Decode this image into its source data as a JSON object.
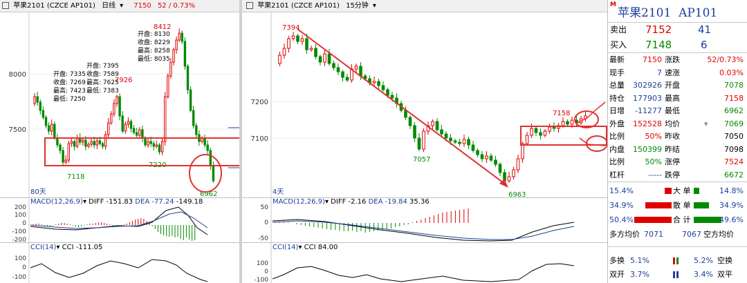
{
  "colors": {
    "up": "#e00000",
    "down": "#008a00",
    "bg": "#ffffff",
    "grid": "#d8d8d8",
    "annot": "#e03030",
    "blue": "#1d3f9c"
  },
  "left_panel": {
    "header": {
      "name": "苹果2101 (CZCE AP101)",
      "period": "日线",
      "dropdown": "▾",
      "price": "7150",
      "change": "52 / 0.73%"
    },
    "price_axis": [
      "8000",
      "7500"
    ],
    "peak_label": "8412",
    "labels": {
      "l7926": "7926",
      "l7220": "7220",
      "l7118": "7118",
      "l6962": "6962"
    },
    "days_label": "80天",
    "tooltip1": {
      "lines": [
        "开盘: 7335",
        "收盘: 7269",
        "最高: 7423",
        "最低: 7250"
      ]
    },
    "tooltip2": {
      "lines": [
        "开盘: 7395",
        "收盘: 7589",
        "最高: 7625",
        "最低: 7383"
      ]
    },
    "tooltip3": {
      "lines": [
        "开盘: 8130",
        "收盘: 8229",
        "最高: 8258",
        "最低: 8035"
      ]
    },
    "macd": {
      "title": "MACD(12,26,9)",
      "dropdown": "▾",
      "diff": "DIFF -151.83",
      "dea": "DEA -77.24",
      "macd": "-149.18",
      "axis": [
        "200",
        "100",
        "0",
        "-100",
        "-200"
      ]
    },
    "cci": {
      "title": "CCI(14)",
      "dropdown": "▾",
      "value": "CCI -111.05",
      "axis": [
        "100",
        "0",
        "-100"
      ]
    }
  },
  "right_panel": {
    "header": {
      "name": "苹果2101 (CZCE AP101)",
      "period": "15分钟",
      "dropdown": "▾"
    },
    "price_axis": [
      "7200",
      "7100"
    ],
    "labels": {
      "l7394": "7394",
      "l7057": "7057",
      "l6963": "6963",
      "l7158": "7158"
    },
    "days_label": "4天",
    "macd": {
      "title": "MACD(12,26,9)",
      "dropdown": "▾",
      "diff": "DIFF -2.16",
      "dea": "DEA -19.84",
      "macd": "35.36",
      "axis": [
        "50",
        "0",
        "-50"
      ]
    },
    "cci": {
      "title": "CCI(14)",
      "dropdown": "▾",
      "value": "CCI 84.00",
      "axis": [
        "100",
        "0",
        "-100"
      ]
    }
  },
  "quote": {
    "mark": "M",
    "title": "苹果2101  AP101",
    "ask": {
      "label": "卖出",
      "price": "7152",
      "vol": "41"
    },
    "bid": {
      "label": "买入",
      "price": "7148",
      "vol": "6"
    },
    "rows": [
      {
        "l1": "最新",
        "v1": "7150",
        "c1": "red",
        "l2": "涨跌",
        "v2": "52/0.73%",
        "c2": "red"
      },
      {
        "l1": "现手",
        "v1": "7",
        "c1": "blu",
        "l2": "速涨",
        "v2": "0.03%",
        "c2": "red"
      },
      {
        "l1": "总量",
        "v1": "302926",
        "c1": "blu",
        "l2": "开盘",
        "v2": "7078",
        "c2": "grn"
      },
      {
        "l1": "持仓",
        "v1": "177903",
        "c1": "blu",
        "l2": "最高",
        "v2": "7158",
        "c2": "red"
      },
      {
        "l1": "日增",
        "v1": "-11277",
        "c1": "blu",
        "l2": "最低",
        "v2": "6962",
        "c2": "grn"
      },
      {
        "l1": "外盘",
        "v1": "152528",
        "c1": "red",
        "l2": "均价",
        "v2": "7069",
        "c2": "grn"
      },
      {
        "l1": "比例",
        "v1": "50%",
        "c1": "red",
        "l2": "昨收",
        "v2": "7050",
        "c2": "blk"
      },
      {
        "l1": "内盘",
        "v1": "150399",
        "c1": "grn",
        "l2": "昨结",
        "v2": "7098",
        "c2": "blk"
      },
      {
        "l1": "比例",
        "v1": "50%",
        "c1": "grn",
        "l2": "涨停",
        "v2": "7524",
        "c2": "red"
      },
      {
        "l1": "杠杆",
        "v1": "-----",
        "c1": "blu",
        "l2": "跌停",
        "v2": "6672",
        "c2": "grn"
      }
    ],
    "avg_dropdown": "▾",
    "flows": [
      {
        "left": "15.4%",
        "label": "大 单",
        "right": "14.8%"
      },
      {
        "left": "34.9%",
        "label": "散 单",
        "right": "34.9%"
      },
      {
        "left": "50.4%",
        "label": "合 计",
        "right": "49.6%"
      }
    ],
    "avg_line": {
      "long_label": "多方均价",
      "long": "7071",
      "short": "7067",
      "short_label": "空方均价"
    },
    "bottom": [
      {
        "l": "多换",
        "lv": "5.1%",
        "rv": "5.2%",
        "r": "空换"
      },
      {
        "l": "双开",
        "lv": "3.7%",
        "rv": "3.4%",
        "r": "双平"
      }
    ]
  }
}
